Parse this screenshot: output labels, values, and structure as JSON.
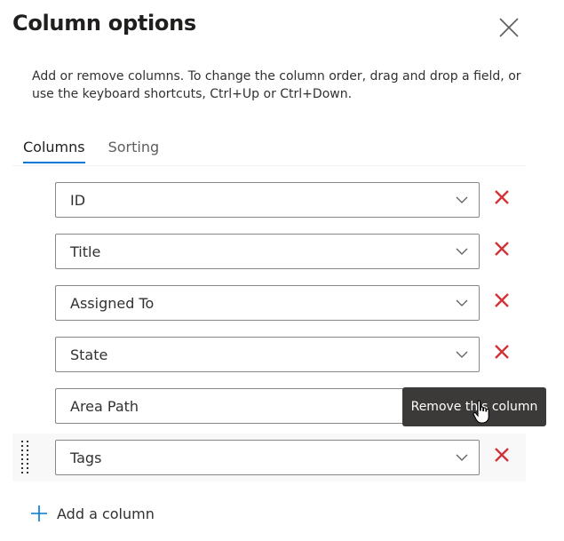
{
  "panel": {
    "title": "Column options",
    "description": "Add or remove columns. To change the column order, drag and drop a field, or use the keyboard shortcuts, Ctrl+Up or Ctrl+Down."
  },
  "tabs": [
    {
      "label": "Columns",
      "active": true
    },
    {
      "label": "Sorting",
      "active": false
    }
  ],
  "columns": [
    {
      "label": "ID"
    },
    {
      "label": "Title"
    },
    {
      "label": "Assigned To"
    },
    {
      "label": "State"
    },
    {
      "label": "Area Path"
    },
    {
      "label": "Tags"
    }
  ],
  "tooltip": {
    "text": "Remove this column"
  },
  "add_column": {
    "label": "Add a column"
  },
  "colors": {
    "accent": "#0078d4",
    "remove": "#d13438",
    "tooltip_bg": "#3b3a39"
  }
}
